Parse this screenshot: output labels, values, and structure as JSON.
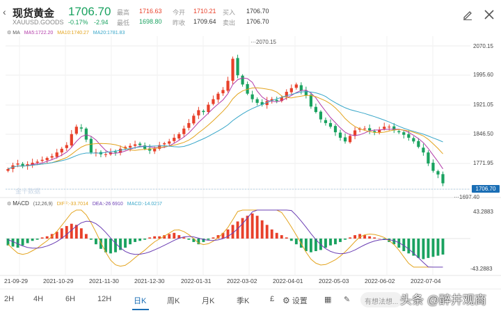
{
  "header": {
    "title": "现货黄金",
    "symbol": "XAUUSD.GOODS",
    "price": "1706.70",
    "change_pct": "-0.17%",
    "change_abs": "-2.94",
    "stats": {
      "high_label": "最高",
      "high": "1716.63",
      "low_label": "最低",
      "low": "1698.80",
      "open_label": "今开",
      "open": "1710.21",
      "prev_close_label": "昨收",
      "prev_close": "1709.64",
      "bid_label": "买入",
      "bid": "1706.70",
      "ask_label": "卖出",
      "ask": "1706.70"
    }
  },
  "indicators": {
    "ma_label": "MA",
    "ma5": "MA5:1722.20",
    "ma10": "MA10:1740.27",
    "ma20": "MA20:1781.83",
    "macd_label": "MACD",
    "macd_params": "(12,26,9)",
    "diff": "DIFF:-33.7014",
    "dea": "DEA:-26.6910",
    "macd": "MACD:-14.0267"
  },
  "colors": {
    "up": "#e8402a",
    "down": "#1aa260",
    "ma5": "#b23aa8",
    "ma10": "#e3a31c",
    "ma20": "#37a6c8",
    "dea": "#6a3db3",
    "accent": "#1a6eb5"
  },
  "chart_data": {
    "type": "candlestick",
    "price_axis": [
      "2070.15",
      "1995.60",
      "1921.05",
      "1846.50",
      "1771.95",
      "1697.40"
    ],
    "macd_axis": [
      "43.2883",
      "-43.2883"
    ],
    "current_price_tag": "1706.70",
    "high_marker": "2070.15",
    "low_marker": "1697.40",
    "dates": [
      "21-09-29",
      "2021-10-29",
      "2021-11-30",
      "2021-12-30",
      "2022-01-31",
      "2022-03-02",
      "2022-04-01",
      "2022-05-03",
      "2022-06-02",
      "2022-07-04"
    ],
    "close_series": [
      1745,
      1755,
      1760,
      1752,
      1758,
      1762,
      1765,
      1770,
      1775,
      1780,
      1790,
      1800,
      1810,
      1840,
      1860,
      1855,
      1825,
      1790,
      1790,
      1785,
      1785,
      1790,
      1790,
      1800,
      1805,
      1808,
      1812,
      1810,
      1800,
      1795,
      1800,
      1810,
      1815,
      1820,
      1830,
      1840,
      1855,
      1870,
      1890,
      1905,
      1900,
      1920,
      1935,
      1950,
      1960,
      1985,
      2045,
      2000,
      1975,
      1950,
      1935,
      1925,
      1920,
      1930,
      1935,
      1930,
      1940,
      1955,
      1965,
      1975,
      1958,
      1945,
      1915,
      1900,
      1880,
      1870,
      1860,
      1845,
      1830,
      1820,
      1835,
      1850,
      1855,
      1855,
      1850,
      1845,
      1852,
      1860,
      1860,
      1850,
      1845,
      1838,
      1830,
      1820,
      1805,
      1790,
      1760,
      1740,
      1730,
      1706
    ],
    "macd_histogram": [
      -6,
      -7,
      -8,
      -6,
      -4,
      -2,
      -1,
      1,
      2,
      4,
      6,
      9,
      11,
      13,
      12,
      9,
      4,
      -1,
      -5,
      -9,
      -12,
      -13,
      -12,
      -10,
      -8,
      -5,
      -3,
      -2,
      -1,
      1,
      2,
      2,
      3,
      4,
      5,
      3,
      1,
      -1,
      -3,
      -5,
      -3,
      -1,
      1,
      3,
      5,
      8,
      12,
      15,
      18,
      20,
      22,
      20,
      16,
      12,
      8,
      5,
      3,
      1,
      -2,
      -5,
      -8,
      -11,
      -12,
      -11,
      -10,
      -8,
      -6,
      -5,
      -3,
      -1,
      1,
      3,
      4,
      3,
      2,
      1,
      0,
      -1,
      -3,
      -5,
      -8,
      -11,
      -13,
      -15,
      -17,
      -18,
      -17,
      -16,
      -15,
      -14
    ]
  },
  "tabs": [
    "2H",
    "4H",
    "6H",
    "12H",
    "日K",
    "周K",
    "月K",
    "季K",
    "£"
  ],
  "tab_active_index": 4,
  "tools": {
    "settings": "设置",
    "input_placeholder": "有想法想..."
  },
  "watermark": "头条 @醉井观商",
  "source_watermark": "金十数据"
}
